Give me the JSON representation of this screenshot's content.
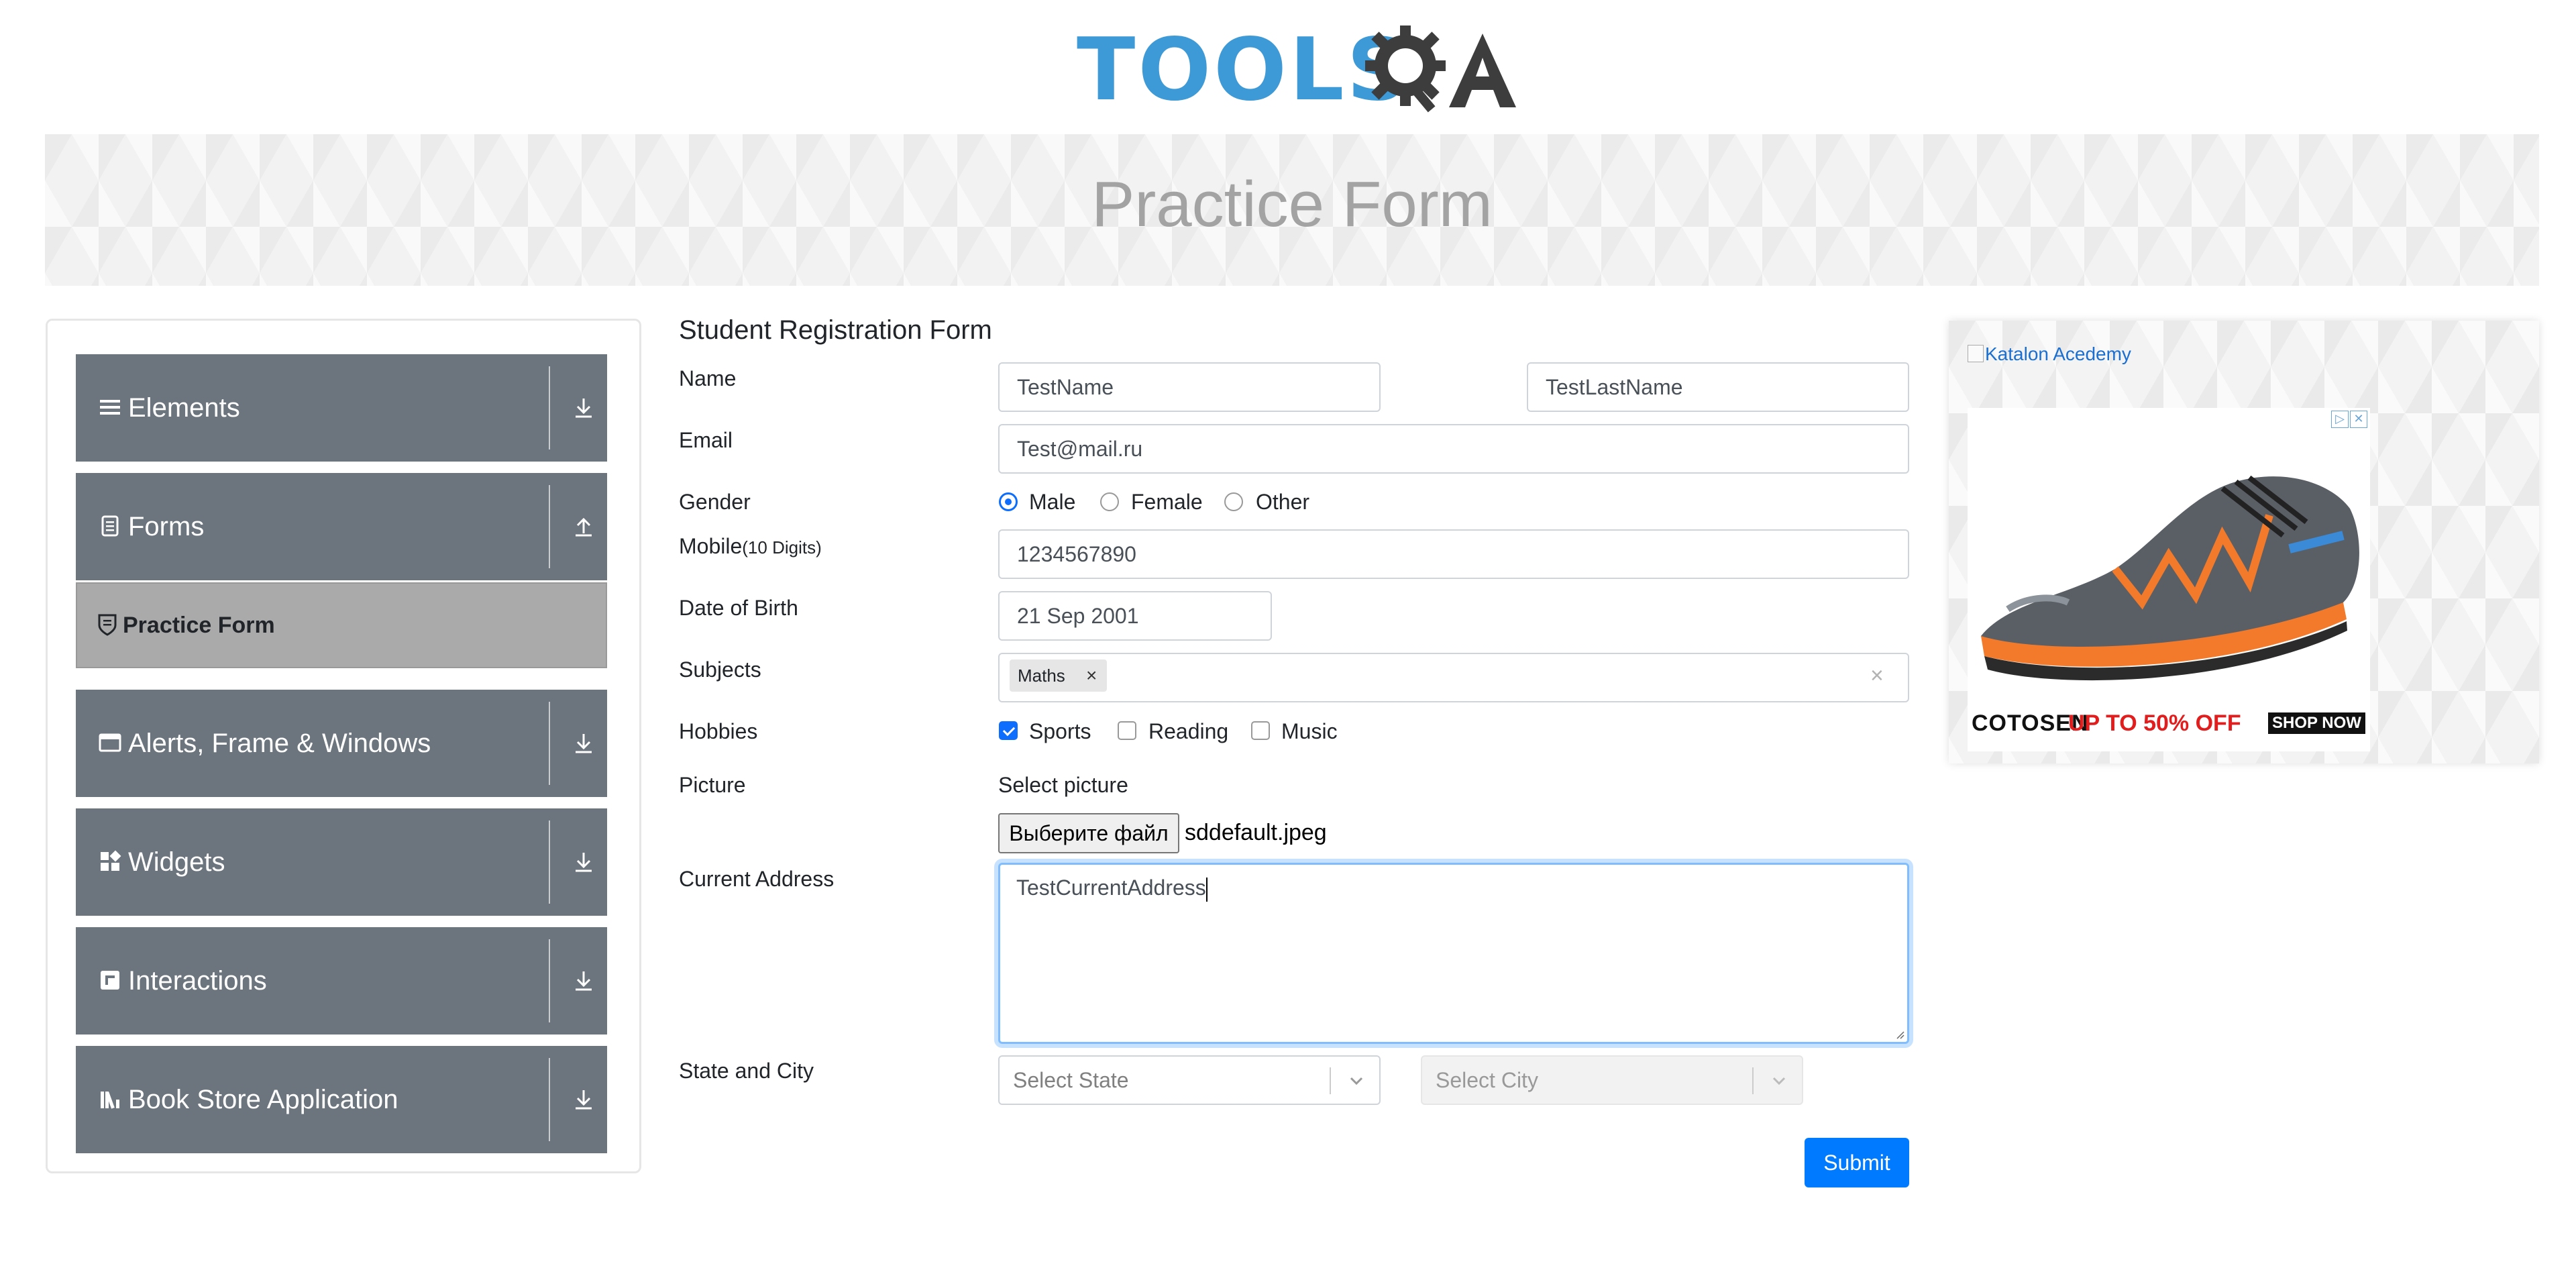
{
  "header": {
    "logo_text": "TOOLS",
    "logo_qa": "QA",
    "page_title": "Practice Form",
    "brand_color": "#3d9ad6"
  },
  "sidebar": {
    "groups": [
      {
        "label": "Elements",
        "icon": "hamburger-icon",
        "arrow": "download-icon"
      },
      {
        "label": "Forms",
        "icon": "document-icon",
        "arrow": "upload-icon"
      },
      {
        "label": "Alerts, Frame & Windows",
        "icon": "window-icon",
        "arrow": "download-icon"
      },
      {
        "label": "Widgets",
        "icon": "widgets-icon",
        "arrow": "download-icon"
      },
      {
        "label": "Interactions",
        "icon": "interactions-icon",
        "arrow": "download-icon"
      },
      {
        "label": "Book Store Application",
        "icon": "books-icon",
        "arrow": "download-icon"
      }
    ],
    "active_item": {
      "label": "Practice Form",
      "icon": "shield-icon"
    },
    "group_color": "#6c757d",
    "active_color": "#aaaaaa"
  },
  "form": {
    "title": "Student Registration Form",
    "name": {
      "label": "Name",
      "first": "TestName",
      "last": "TestLastName"
    },
    "email": {
      "label": "Email",
      "value": "Test@mail.ru"
    },
    "gender": {
      "label": "Gender",
      "options": [
        "Male",
        "Female",
        "Other"
      ],
      "selected": "Male"
    },
    "mobile": {
      "label": "Mobile",
      "hint": "(10 Digits)",
      "value": "1234567890"
    },
    "dob": {
      "label": "Date of Birth",
      "value": "21 Sep 2001"
    },
    "subjects": {
      "label": "Subjects",
      "chips": [
        "Maths"
      ],
      "remove": "×",
      "clear": "×"
    },
    "hobbies": {
      "label": "Hobbies",
      "options": [
        "Sports",
        "Reading",
        "Music"
      ],
      "checked": [
        "Sports"
      ]
    },
    "picture": {
      "label": "Picture",
      "caption": "Select picture",
      "button": "Выберите файл",
      "file": "sddefault.jpeg"
    },
    "address": {
      "label": "Current Address",
      "value": "TestCurrentAddress"
    },
    "state_city": {
      "label": "State and City",
      "state_placeholder": "Select State",
      "city_placeholder": "Select City"
    },
    "submit": "Submit",
    "accent_color": "#007bff"
  },
  "ad": {
    "link_alt": "Katalon Acedemy",
    "brand": "COTOSEN",
    "promo": "UP TO 50% OFF",
    "cta": "SHOP NOW",
    "controls": [
      "▷",
      "✕"
    ]
  }
}
